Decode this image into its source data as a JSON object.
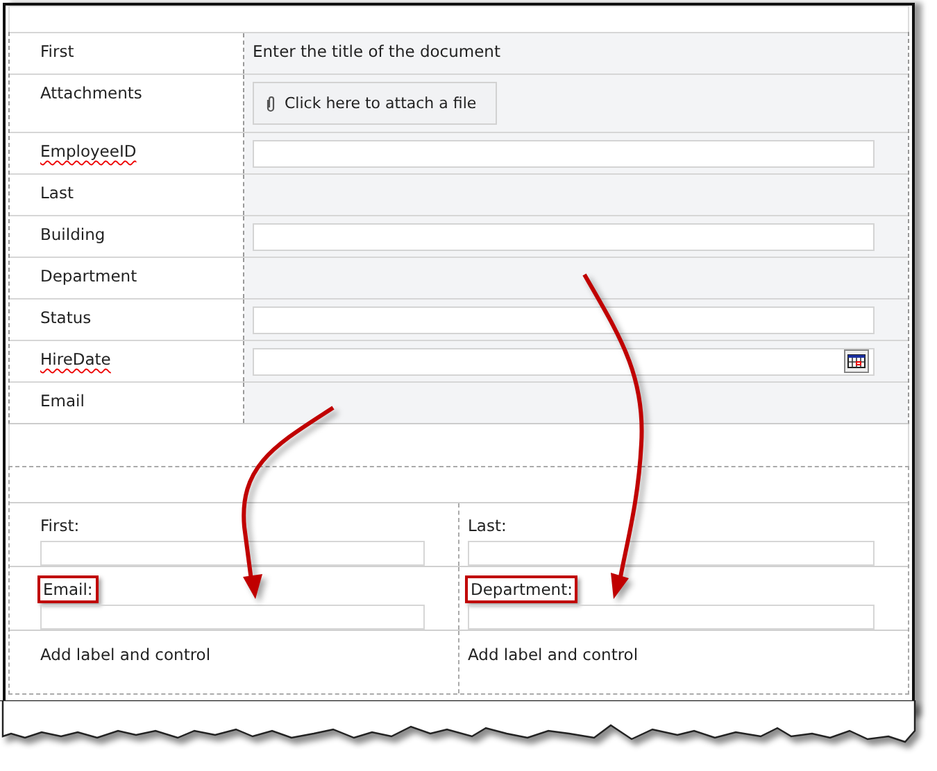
{
  "form": {
    "rows": [
      {
        "label": "First",
        "misspelled": false,
        "kind": "text",
        "text": "Enter the title of the document"
      },
      {
        "label": "Attachments",
        "misspelled": false,
        "kind": "attach",
        "text": "Click here to attach a file"
      },
      {
        "label": "EmployeeID",
        "misspelled": true,
        "kind": "input"
      },
      {
        "label": "Last",
        "misspelled": false,
        "kind": "empty"
      },
      {
        "label": "Building",
        "misspelled": false,
        "kind": "input"
      },
      {
        "label": "Department",
        "misspelled": false,
        "kind": "empty"
      },
      {
        "label": "Status",
        "misspelled": false,
        "kind": "input"
      },
      {
        "label": "HireDate",
        "misspelled": true,
        "kind": "date"
      },
      {
        "label": "Email",
        "misspelled": false,
        "kind": "empty"
      }
    ]
  },
  "layout": {
    "rows": [
      [
        {
          "kind": "field",
          "label": "First:",
          "highlighted": false
        },
        {
          "kind": "field",
          "label": "Last:",
          "highlighted": false
        }
      ],
      [
        {
          "kind": "field",
          "label": "Email:",
          "highlighted": true
        },
        {
          "kind": "field",
          "label": "Department:",
          "highlighted": true
        }
      ],
      [
        {
          "kind": "add",
          "label": "Add label and control"
        },
        {
          "kind": "add",
          "label": "Add label and control"
        }
      ]
    ]
  }
}
